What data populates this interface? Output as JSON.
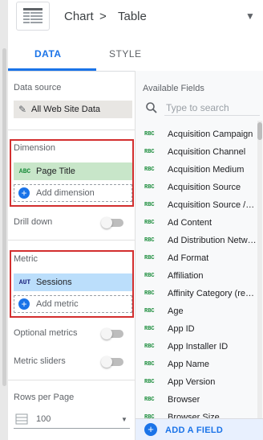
{
  "header": {
    "crumb_chart": "Chart",
    "crumb_sep": ">",
    "crumb_table": "Table"
  },
  "tabs": [
    {
      "label": "DATA",
      "active": true
    },
    {
      "label": "STYLE",
      "active": false
    }
  ],
  "data_source": {
    "label": "Data source",
    "value": "All Web Site Data"
  },
  "dimension": {
    "label": "Dimension",
    "chip_type": "ABC",
    "chip_value": "Page Title",
    "add_label": "Add dimension"
  },
  "drill_down": {
    "label": "Drill down",
    "enabled": false
  },
  "metric": {
    "label": "Metric",
    "chip_type": "AUT",
    "chip_value": "Sessions",
    "add_label": "Add metric"
  },
  "optional_metrics": {
    "label": "Optional metrics",
    "enabled": false
  },
  "metric_sliders": {
    "label": "Metric sliders",
    "enabled": false
  },
  "rows_per_page": {
    "label": "Rows per Page",
    "value": "100"
  },
  "available_fields": {
    "title": "Available Fields",
    "search_placeholder": "Type to search",
    "type_tag": "RBC",
    "fields": [
      "Acquisition Campaign",
      "Acquisition Channel",
      "Acquisition Medium",
      "Acquisition Source",
      "Acquisition Source / M...",
      "Ad Content",
      "Ad Distribution Netwo...",
      "Ad Format",
      "Affiliation",
      "Affinity Category (reac...",
      "Age",
      "App ID",
      "App Installer ID",
      "App Name",
      "App Version",
      "Browser",
      "Browser Size"
    ],
    "add_field_label": "ADD A FIELD"
  },
  "colors": {
    "accent": "#1a73e8",
    "highlight_border": "#d32f2f",
    "dimension_chip": "#c8e6c9",
    "metric_chip": "#bbdefb"
  }
}
